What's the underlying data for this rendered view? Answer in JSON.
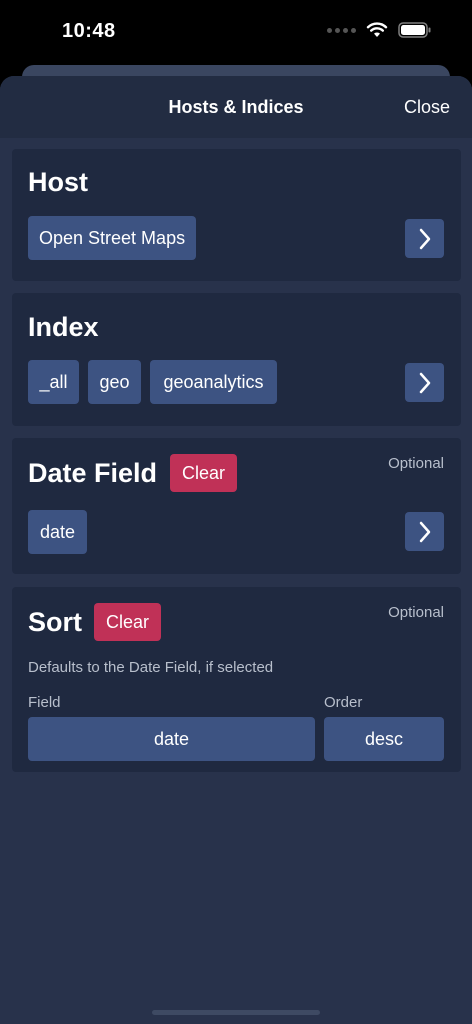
{
  "status_bar": {
    "time": "10:48"
  },
  "nav": {
    "title": "Hosts & Indices",
    "close_label": "Close"
  },
  "host": {
    "title": "Host",
    "value": "Open Street Maps"
  },
  "index": {
    "title": "Index",
    "chips": [
      "_all",
      "geo",
      "geoanalytics"
    ]
  },
  "date_field": {
    "title": "Date Field",
    "clear_label": "Clear",
    "optional_label": "Optional",
    "value": "date"
  },
  "sort": {
    "title": "Sort",
    "clear_label": "Clear",
    "optional_label": "Optional",
    "hint": "Defaults to the Date Field, if selected",
    "field_label": "Field",
    "order_label": "Order",
    "field_value": "date",
    "order_value": "desc"
  },
  "colors": {
    "sheet": "#28324b",
    "card": "#1f2940",
    "chip": "#3d5382",
    "clear": "#c03157"
  }
}
